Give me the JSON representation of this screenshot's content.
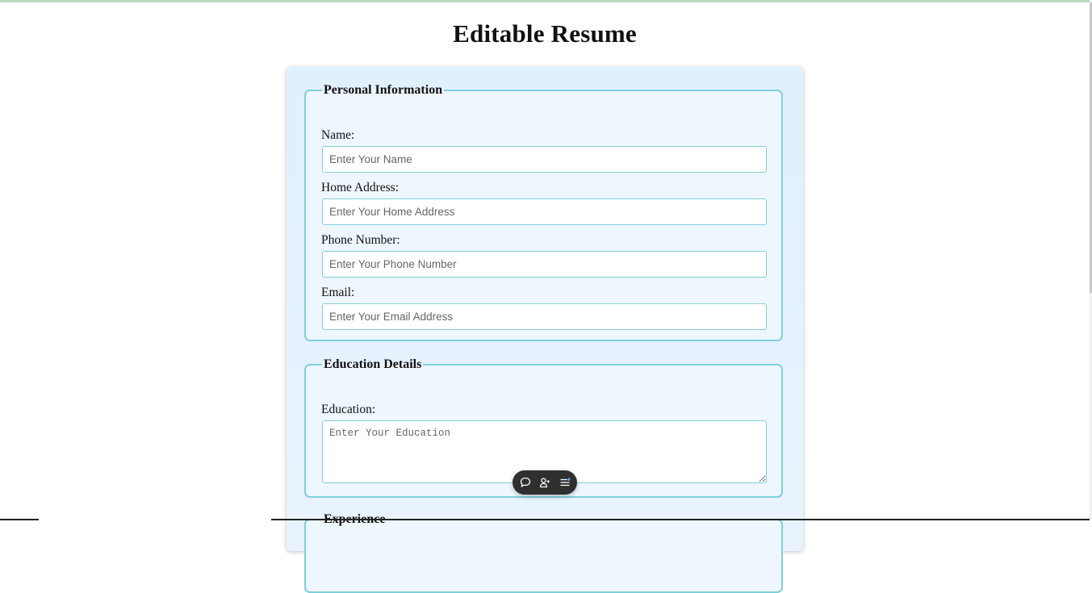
{
  "page": {
    "title": "Editable Resume"
  },
  "personal": {
    "legend": "Personal Information",
    "fields": [
      {
        "label": "Name:",
        "placeholder": "Enter Your Name",
        "value": ""
      },
      {
        "label": "Home Address:",
        "placeholder": "Enter Your Home Address",
        "value": ""
      },
      {
        "label": "Phone Number:",
        "placeholder": "Enter Your Phone Number",
        "value": ""
      },
      {
        "label": "Email:",
        "placeholder": "Enter Your Email Address",
        "value": ""
      }
    ]
  },
  "education": {
    "legend": "Education Details",
    "label": "Education:",
    "placeholder": "Enter Your Education",
    "value": ""
  },
  "experience": {
    "legend": "Experience"
  },
  "toolbar": {
    "icons": [
      "comment-icon",
      "add-user-icon",
      "list-menu-icon"
    ]
  },
  "colors": {
    "card_background": "#e1f0fd",
    "fieldset_border": "#7fcfdb",
    "toolbar_background": "#2f2f2f",
    "badge_dot": "#4aa3ff"
  }
}
